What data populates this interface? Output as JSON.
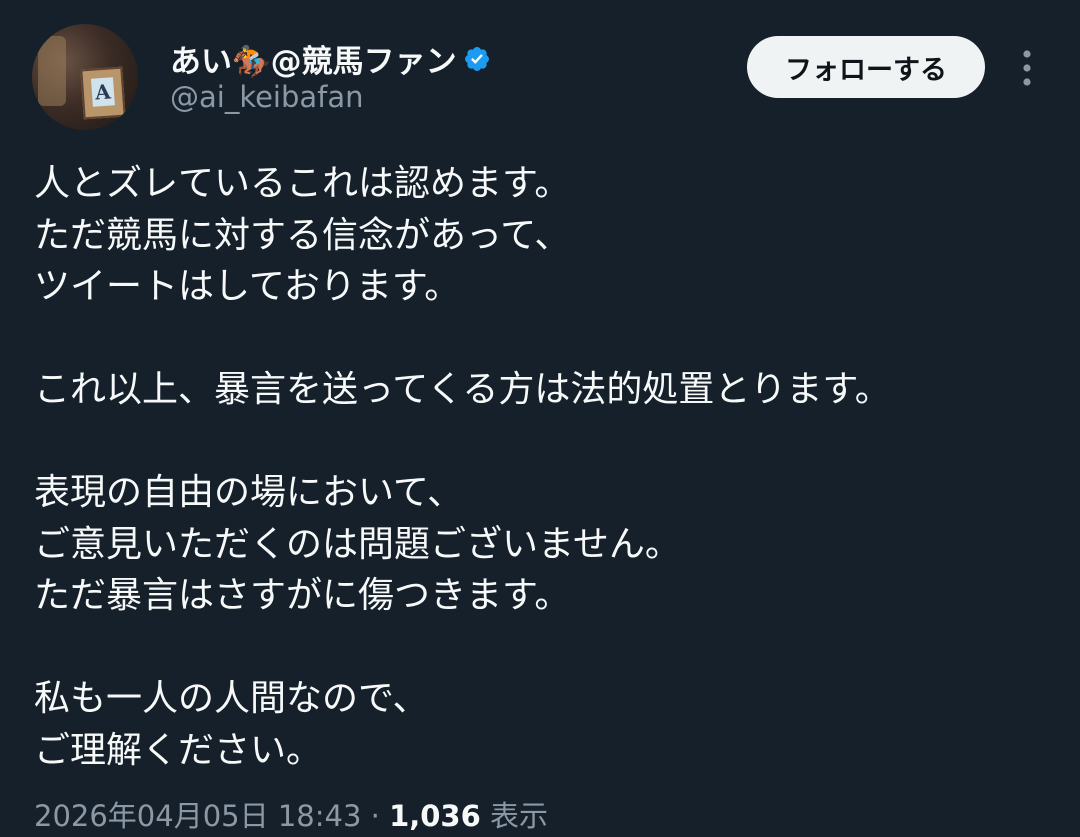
{
  "user": {
    "display_name": "あい🏇@競馬ファン",
    "handle": "@ai_keibafan",
    "verified": true,
    "avatar_letter": "A"
  },
  "actions": {
    "follow_label": "フォローする",
    "more_icon": "more-vertical-icon"
  },
  "tweet": {
    "lines": [
      "人とズレているこれは認めます。",
      "ただ競馬に対する信念があって、",
      "ツイートはしております。",
      "",
      "これ以上、暴言を送ってくる方は法的処置とります。",
      "",
      "表現の自由の場において、",
      "ご意見いただくのは問題ございません。",
      "ただ暴言はさすがに傷つきます。",
      "",
      "私も一人の人間なので、",
      "ご理解ください。"
    ],
    "timestamp": "2026年04月05日 18:43",
    "separator": " · ",
    "views_count": "1,036",
    "views_label": " 表示"
  },
  "colors": {
    "background": "#15202b",
    "text_primary": "#f7f9f9",
    "text_secondary": "#8b98a5",
    "verified_blue": "#1d9bf0",
    "follow_button_bg": "#eff3f4"
  }
}
